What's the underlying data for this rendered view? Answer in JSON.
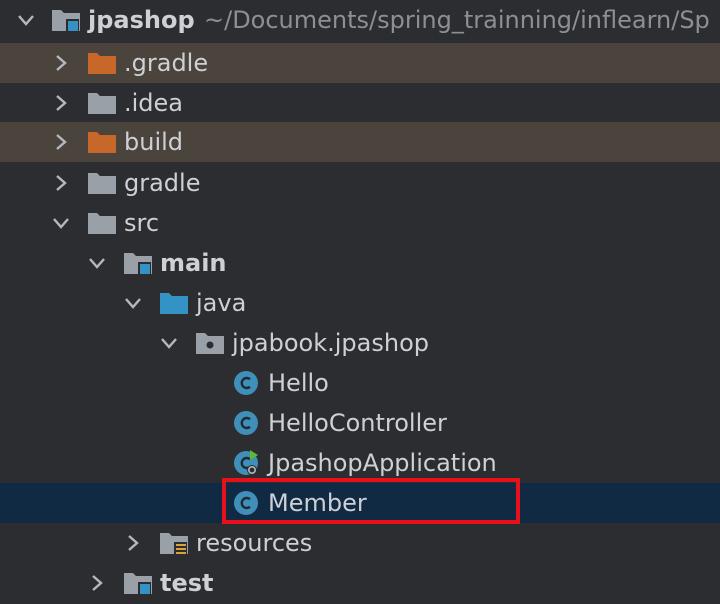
{
  "project": {
    "name": "jpashop",
    "path": "~/Documents/spring_trainning/inflearn/Sp"
  },
  "tree": {
    "gradle_dir": ".gradle",
    "idea_dir": ".idea",
    "build_dir": "build",
    "gradle_wrapper_dir": "gradle",
    "src_dir": "src",
    "main_dir": "main",
    "java_dir": "java",
    "package": "jpabook.jpashop",
    "classes": [
      "Hello",
      "HelloController",
      "JpashopApplication",
      "Member"
    ],
    "resources_dir": "resources",
    "test_dir": "test"
  },
  "icons": {
    "excluded_folder": "orange-folder-icon",
    "folder": "gray-folder-icon",
    "module_folder": "module-folder-icon",
    "source_folder": "blue-source-folder-icon",
    "package": "package-icon",
    "class": "class-c-icon",
    "spring_boot_class": "spring-boot-class-icon",
    "resources_folder": "resources-folder-icon"
  },
  "colors": {
    "background": "#2b2d30",
    "excluded_row": "#4a443c",
    "selected_row": "#102a43",
    "highlight_border": "#e8101a",
    "excluded_folder": "#c7672a",
    "folder": "#9aa0a8",
    "source_folder": "#3592c4",
    "class_icon": "#3f8fb8"
  },
  "selection": {
    "selected_item": "Member",
    "highlighted": true
  }
}
